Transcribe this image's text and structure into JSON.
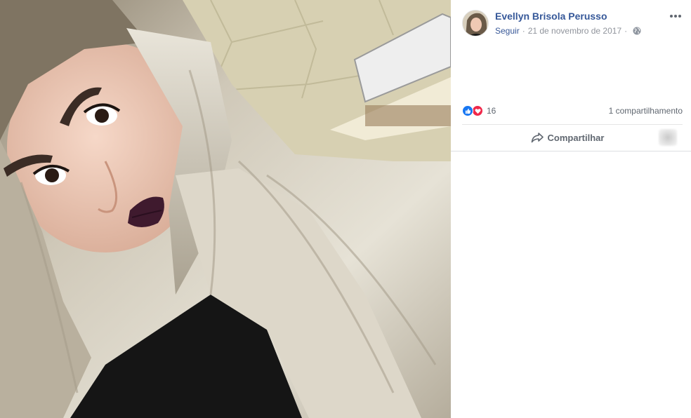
{
  "post": {
    "author": "Evellyn Brisola Perusso",
    "follow_label": "Seguir",
    "separator": "·",
    "date": "21 de novembro de 2017",
    "privacy_icon": "globe-icon",
    "menu_icon": "more-options-icon"
  },
  "reactions": {
    "icons": [
      "like-reaction-icon",
      "love-reaction-icon"
    ],
    "count": "16",
    "shares": "1 compartilhamento"
  },
  "actions": {
    "share_label": "Compartilhar",
    "share_icon": "share-arrow-icon"
  },
  "colors": {
    "author_link": "#365899",
    "meta_text": "#90949c",
    "like": "#1877f2",
    "love": "#f0284a"
  }
}
